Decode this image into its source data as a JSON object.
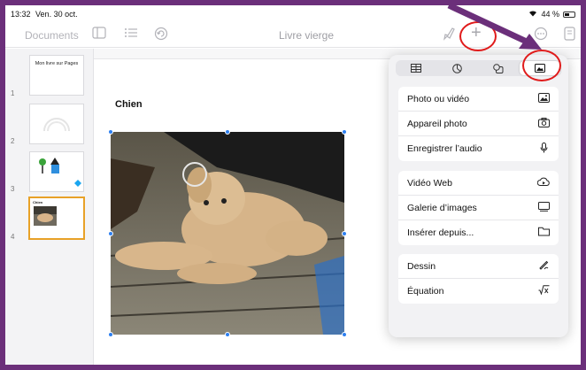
{
  "status": {
    "time": "13:32",
    "date": "Ven. 30 oct.",
    "battery": "44 %"
  },
  "toolbar": {
    "documents_label": "Documents",
    "title": "Livre vierge",
    "sidebar_icon": "sidebar-icon",
    "list_icon": "list-icon",
    "undo_icon": "undo-icon",
    "format_icon": "paintbrush-icon",
    "insert_icon": "plus-icon",
    "media_icon": "photo-icon",
    "more_icon": "more-icon",
    "document_icon": "document-icon"
  },
  "thumbnails": [
    {
      "num": "1",
      "title": "Mon livre sur Pages"
    },
    {
      "num": "2"
    },
    {
      "num": "3"
    },
    {
      "num": "4"
    }
  ],
  "page": {
    "heading": "Chien"
  },
  "popover": {
    "tabs": [
      "table-icon",
      "chart-icon",
      "shape-icon",
      "media-icon"
    ],
    "groups": [
      [
        {
          "label": "Photo ou vidéo",
          "icon": "photo-icon"
        },
        {
          "label": "Appareil photo",
          "icon": "camera-icon"
        },
        {
          "label": "Enregistrer l’audio",
          "icon": "microphone-icon"
        }
      ],
      [
        {
          "label": "Vidéo Web",
          "icon": "web-video-icon"
        },
        {
          "label": "Galerie d’images",
          "icon": "gallery-icon"
        },
        {
          "label": "Insérer depuis...",
          "icon": "folder-icon"
        }
      ],
      [
        {
          "label": "Dessin",
          "icon": "pencil-icon"
        },
        {
          "label": "Équation",
          "icon": "equation-icon"
        }
      ]
    ]
  },
  "colors": {
    "frame": "#6b2f7a",
    "accent": "#e8a127",
    "annotation": "#e01b1b",
    "handle": "#2d7ff0"
  }
}
